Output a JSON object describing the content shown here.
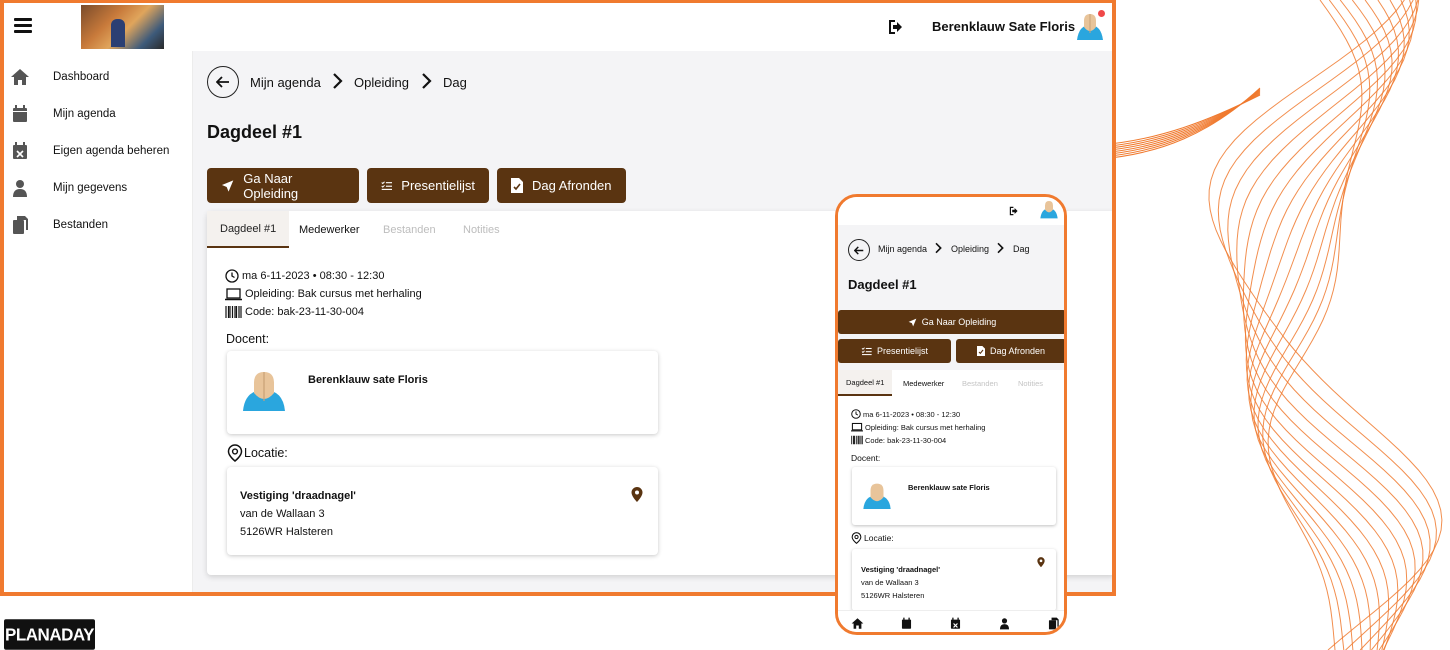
{
  "header": {
    "user_name": "Berenklauw Sate Floris"
  },
  "sidebar": {
    "items": [
      {
        "label": "Dashboard",
        "icon": "home-icon"
      },
      {
        "label": "Mijn agenda",
        "icon": "calendar-icon"
      },
      {
        "label": "Eigen agenda beheren",
        "icon": "calendar-x-icon"
      },
      {
        "label": "Mijn gegevens",
        "icon": "user-icon"
      },
      {
        "label": "Bestanden",
        "icon": "files-icon"
      }
    ]
  },
  "breadcrumb": [
    "Mijn agenda",
    "Opleiding",
    "Dag"
  ],
  "page_title": "Dagdeel #1",
  "actions": {
    "go_training": "Ga Naar Opleiding",
    "attendance": "Presentielijst",
    "finish_day": "Dag Afronden"
  },
  "tabs": [
    {
      "label": "Dagdeel #1",
      "state": "active"
    },
    {
      "label": "Medewerker",
      "state": "normal"
    },
    {
      "label": "Bestanden",
      "state": "disabled"
    },
    {
      "label": "Notities",
      "state": "disabled"
    }
  ],
  "details": {
    "datetime": "ma 6-11-2023 • 08:30 - 12:30",
    "training": "Opleiding: Bak cursus met herhaling",
    "code": "Code: bak-23-11-30-004"
  },
  "docent": {
    "label": "Docent:",
    "name": "Berenklauw sate Floris"
  },
  "location": {
    "label": "Locatie:",
    "name": "Vestiging 'draadnagel'",
    "street": "van de Wallaan 3",
    "city": "5126WR Halsteren"
  },
  "brand": {
    "logo_text": "PLANADAY"
  },
  "colors": {
    "accent": "#f07a2f",
    "primary": "#5a3411",
    "avatar_blue": "#2aa6de",
    "notification": "#f04848"
  }
}
